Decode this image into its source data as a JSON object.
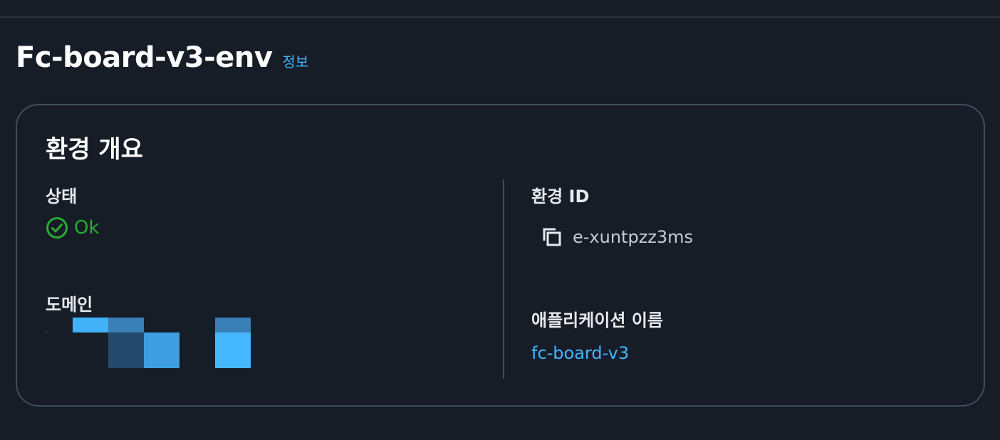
{
  "header": {
    "title": "Fc-board-v3-env",
    "info_label": "정보"
  },
  "overview": {
    "title": "환경 개요",
    "status": {
      "label": "상태",
      "value": "Ok",
      "color": "#29ad32"
    },
    "domain": {
      "label": "도메인"
    },
    "environment_id": {
      "label": "환경 ID",
      "value": "e-xuntpzz3ms",
      "copy_icon": "copy-icon"
    },
    "application_name": {
      "label": "애플리케이션 이름",
      "value": "fc-board-v3"
    }
  },
  "colors": {
    "background": "#161d27",
    "link": "#42b4ff",
    "border": "#414d5c",
    "status_ok": "#29ad32"
  }
}
